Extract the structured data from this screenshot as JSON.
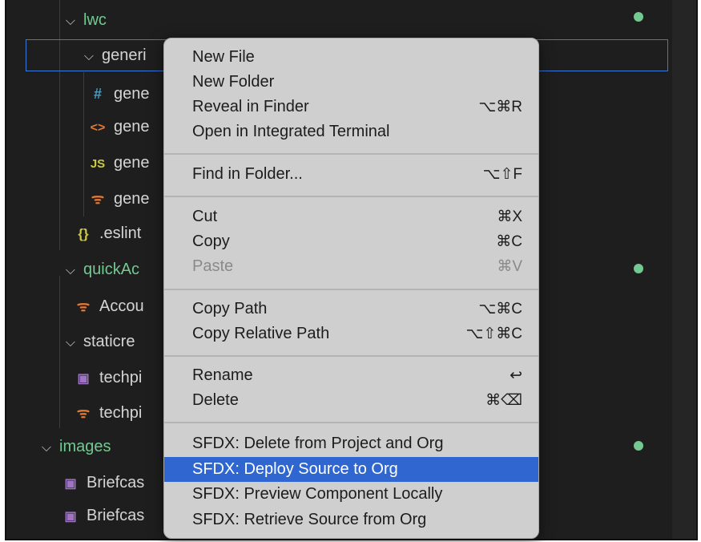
{
  "explorer": {
    "rows": [
      {
        "label": "lwc"
      },
      {
        "label": "generi"
      },
      {
        "icon": "#",
        "label": "gene"
      },
      {
        "icon": "<>",
        "label": "gene"
      },
      {
        "icon": "JS",
        "label": "gene"
      },
      {
        "icon": "rss",
        "label": "gene"
      },
      {
        "icon": "{}",
        "label": ".eslint"
      },
      {
        "label": "quickAc"
      },
      {
        "icon": "rss",
        "label": "Accou"
      },
      {
        "label": "staticre"
      },
      {
        "icon": "img",
        "label": "techpi"
      },
      {
        "icon": "rss",
        "label": "techpi"
      },
      {
        "label": "images"
      },
      {
        "icon": "img",
        "label": "Briefcas"
      },
      {
        "icon": "img",
        "label": "Briefcas"
      }
    ]
  },
  "context_menu": {
    "items": [
      {
        "label": "New File",
        "shortcut": ""
      },
      {
        "label": "New Folder",
        "shortcut": ""
      },
      {
        "label": "Reveal in Finder",
        "shortcut": "⌥⌘R"
      },
      {
        "label": "Open in Integrated Terminal",
        "shortcut": ""
      },
      {
        "label": "Find in Folder...",
        "shortcut": "⌥⇧F"
      },
      {
        "label": "Cut",
        "shortcut": "⌘X"
      },
      {
        "label": "Copy",
        "shortcut": "⌘C"
      },
      {
        "label": "Paste",
        "shortcut": "⌘V"
      },
      {
        "label": "Copy Path",
        "shortcut": "⌥⌘C"
      },
      {
        "label": "Copy Relative Path",
        "shortcut": "⌥⇧⌘C"
      },
      {
        "label": "Rename",
        "shortcut": "↩"
      },
      {
        "label": "Delete",
        "shortcut": "⌘⌫"
      },
      {
        "label": "SFDX: Delete from Project and Org",
        "shortcut": ""
      },
      {
        "label": "SFDX: Deploy Source to Org",
        "shortcut": ""
      },
      {
        "label": "SFDX: Preview Component Locally",
        "shortcut": ""
      },
      {
        "label": "SFDX: Retrieve Source from Org",
        "shortcut": ""
      }
    ]
  },
  "colors": {
    "folder_green": "#73c991",
    "highlight": "#2f66d0",
    "selection_border": "#3a79d7"
  }
}
